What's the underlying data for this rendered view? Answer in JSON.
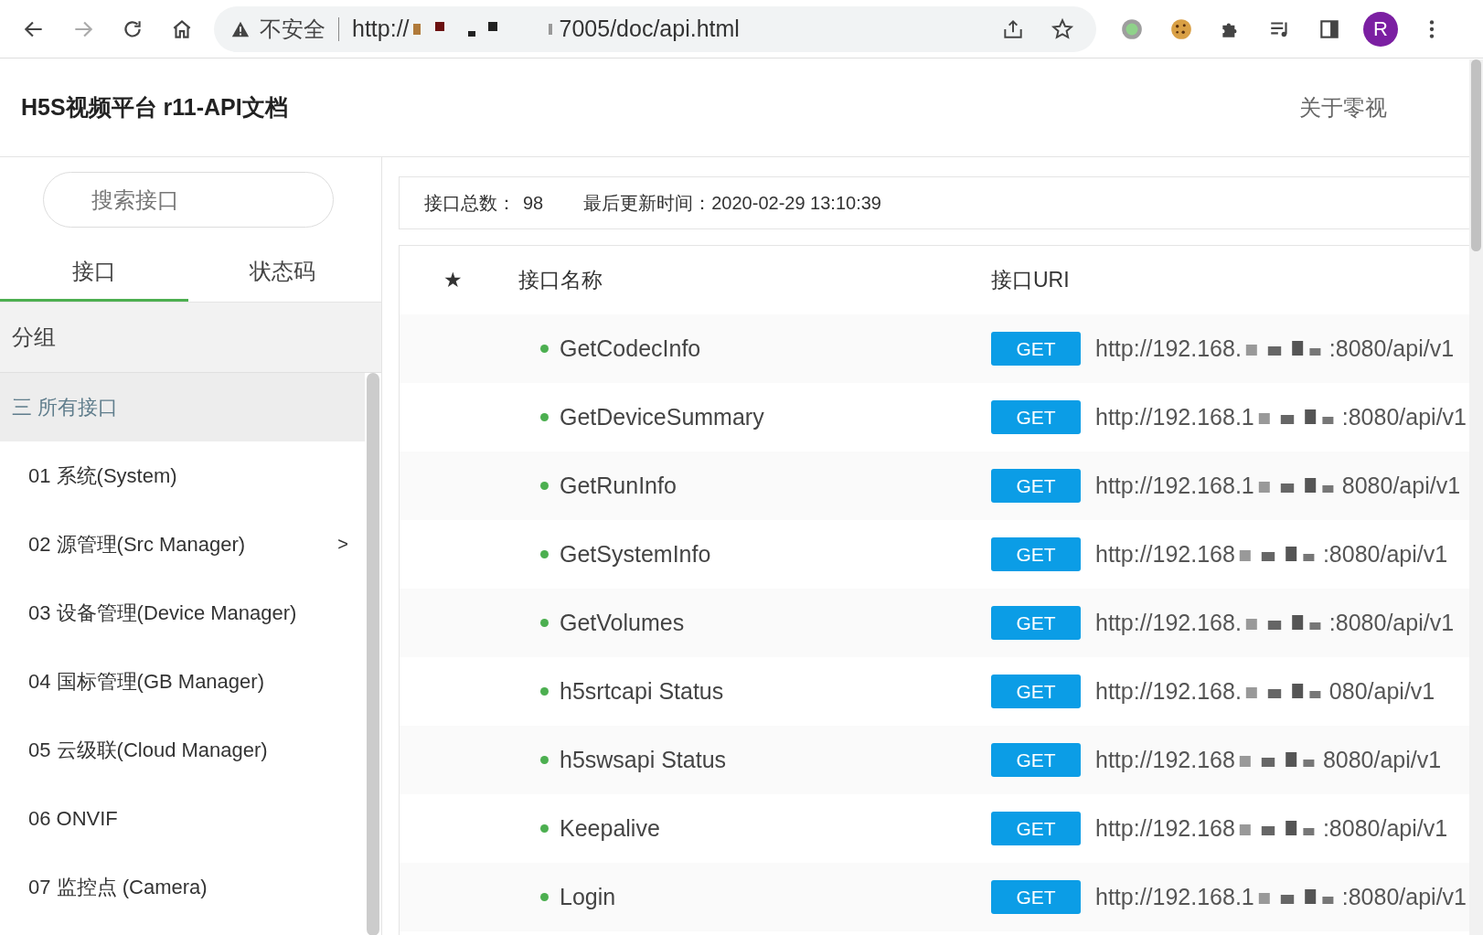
{
  "browser": {
    "security_label": "不安全",
    "url_start": "http://",
    "url_end": "7005/doc/api.html",
    "profile_initial": "R"
  },
  "header": {
    "title": "H5S视频平台 r11-API文档",
    "about_link": "关于零视"
  },
  "sidebar": {
    "search": {
      "placeholder": "搜索接口"
    },
    "tabs": [
      {
        "label": "接口",
        "selected": true
      },
      {
        "label": "状态码",
        "selected": false
      }
    ],
    "group_heading": "分组",
    "items": [
      {
        "label": "所有接口",
        "icon": "三",
        "selected": true
      },
      {
        "label": "01 系统(System)",
        "selected": false
      },
      {
        "label": "02 源管理(Src Manager)",
        "selected": false,
        "arrow": ">"
      },
      {
        "label": "03 设备管理(Device Manager)",
        "selected": false
      },
      {
        "label": "04 国标管理(GB Manager)",
        "selected": false
      },
      {
        "label": "05 云级联(Cloud Manager)",
        "selected": false
      },
      {
        "label": "06 ONVIF",
        "selected": false
      },
      {
        "label": "07 监控点 (Camera)",
        "selected": false
      }
    ]
  },
  "summary": {
    "count_label": "接口总数：",
    "count": "98",
    "updated_label": "最后更新时间：",
    "updated": "2020-02-29 13:10:39"
  },
  "table": {
    "columns": [
      "★",
      "接口名称",
      "接口URI"
    ],
    "rows": [
      {
        "name": "GetCodecInfo",
        "method": "GET",
        "uri_start": "http://192.168.",
        "uri_end": ":8080/api/v1"
      },
      {
        "name": "GetDeviceSummary",
        "method": "GET",
        "uri_start": "http://192.168.1",
        "uri_end": ":8080/api/v1"
      },
      {
        "name": "GetRunInfo",
        "method": "GET",
        "uri_start": "http://192.168.1",
        "uri_end": "8080/api/v1"
      },
      {
        "name": "GetSystemInfo",
        "method": "GET",
        "uri_start": "http://192.168",
        "uri_end": ":8080/api/v1"
      },
      {
        "name": "GetVolumes",
        "method": "GET",
        "uri_start": "http://192.168.",
        "uri_end": ":8080/api/v1"
      },
      {
        "name": "h5srtcapi Status",
        "method": "GET",
        "uri_start": "http://192.168.",
        "uri_end": "080/api/v1"
      },
      {
        "name": "h5swsapi Status",
        "method": "GET",
        "uri_start": "http://192.168",
        "uri_end": "8080/api/v1"
      },
      {
        "name": "Keepalive",
        "method": "GET",
        "uri_start": "http://192.168",
        "uri_end": ":8080/api/v1"
      },
      {
        "name": "Login",
        "method": "GET",
        "uri_start": "http://192.168.1",
        "uri_end": ":8080/api/v1"
      }
    ]
  }
}
